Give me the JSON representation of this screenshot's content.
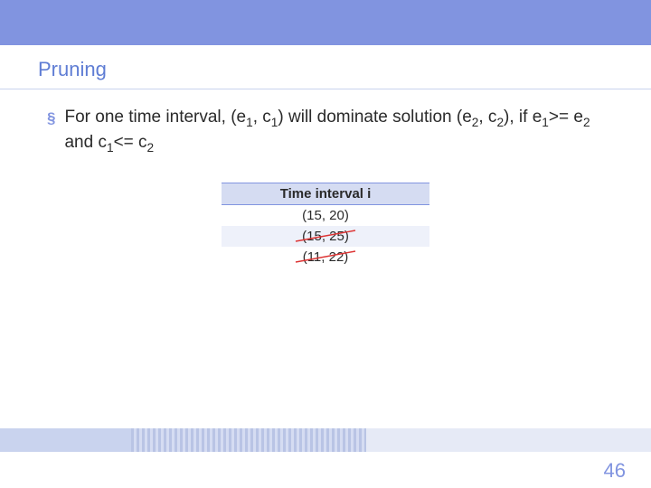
{
  "slide": {
    "title": "Pruning",
    "bullet": {
      "pre": "For one time interval, (e",
      "s1a": "1",
      "mid1": ", c",
      "s1b": "1",
      "mid2": ") will dominate solution (e",
      "s2a": "2",
      "mid3": ", c",
      "s2b": "2",
      "mid4": "), if e",
      "s3a": "1",
      "mid5": ">= e",
      "s3b": "2",
      "mid6": " and c",
      "s4a": "1",
      "mid7": "<= c",
      "s4b": "2"
    },
    "table": {
      "header": "Time interval i",
      "rows": [
        "(15, 20)",
        "(15, 25)",
        "(11, 22)"
      ]
    },
    "page_number": "46"
  }
}
